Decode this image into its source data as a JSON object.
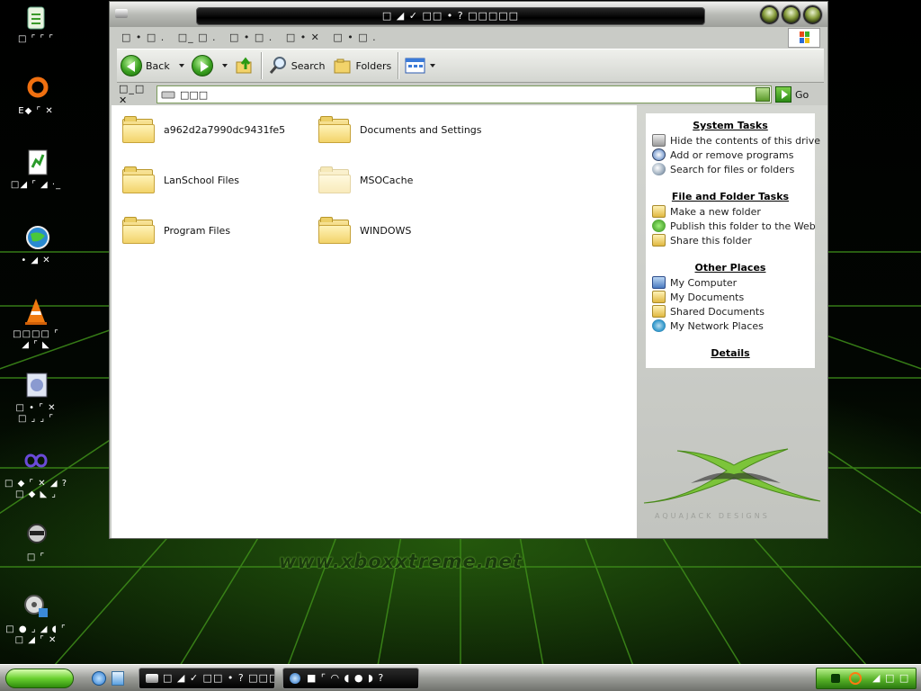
{
  "window": {
    "title": "□ ◢ ✓ □□ • ? □□□□□",
    "menu": [
      "□ • □ .",
      "□_ □ .",
      "□ • □ .",
      "□ • ✕",
      "□ • □ ."
    ]
  },
  "toolbar": {
    "back": "Back",
    "search": "Search",
    "folders": "Folders"
  },
  "address": {
    "label": "□_□ ✕",
    "value": "□□□",
    "go": "Go"
  },
  "folders": [
    {
      "name": "a962d2a7990dc9431fe5",
      "faded": false
    },
    {
      "name": "Documents and Settings",
      "faded": false
    },
    {
      "name": "LanSchool Files",
      "faded": false
    },
    {
      "name": "MSOCache",
      "faded": true
    },
    {
      "name": "Program Files",
      "faded": false
    },
    {
      "name": "WINDOWS",
      "faded": false
    }
  ],
  "sidepanel": {
    "system_tasks": {
      "title": "System Tasks",
      "items": [
        "Hide the contents of this drive",
        "Add or remove programs",
        "Search for files or folders"
      ]
    },
    "file_tasks": {
      "title": "File and Folder Tasks",
      "items": [
        "Make a new folder",
        "Publish this folder to the Web",
        "Share this folder"
      ]
    },
    "other_places": {
      "title": "Other Places",
      "items": [
        "My Computer",
        "My Documents",
        "Shared Documents",
        "My Network Places"
      ]
    },
    "details": {
      "title": "Details"
    },
    "logo_text": "AQUAJACK DESIGNS"
  },
  "desktop": {
    "icons": [
      {
        "label": "□ ⌜ ⌜ ⌜"
      },
      {
        "label": "E◆ ⌜ ✕"
      },
      {
        "label": "□◢ ⌜ ◢ ·_"
      },
      {
        "label": "• ◢ ✕"
      },
      {
        "label": "□□□□ ⌜",
        "label2": "◢ ⌜ ◣"
      },
      {
        "label": "□ • ⌜ ✕",
        "label2": "□ ⌟ ⌟ ⌜"
      },
      {
        "label": "□ ◆ ⌜ ✕ ◢ ?",
        "label2": "□ ◆ ◣ ⌟"
      },
      {
        "label": "□ ⌜"
      },
      {
        "label": "□ ● ⌟ ◢ ◖ ⌜",
        "label2": "□ ◢ ⌜ ✕"
      }
    ],
    "watermark": "www.xboxxtreme.net"
  },
  "taskbar": {
    "tasks": [
      "□ ◢ ✓ □□ • ? □□□□",
      "■ ⌜ ◠ ◖ ● ◗ ?"
    ],
    "clock": "◢ □ □"
  }
}
